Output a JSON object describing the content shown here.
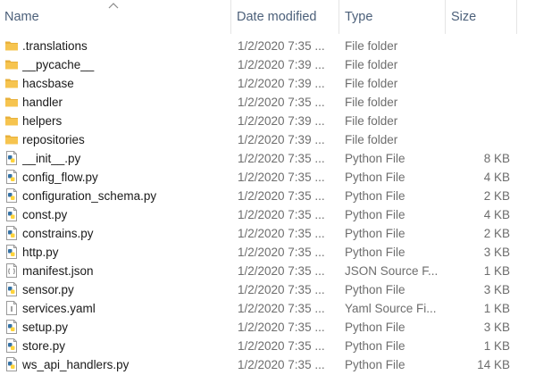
{
  "columns": {
    "name": "Name",
    "date_modified": "Date modified",
    "type": "Type",
    "size": "Size"
  },
  "colors": {
    "folder": "#f6c44f",
    "python_blue": "#3572a5",
    "python_yellow": "#ffd43b",
    "header_text": "#4c607a",
    "secondary_text": "#6d6d6d"
  },
  "files": [
    {
      "name": ".translations",
      "date": "1/2/2020 7:35 ...",
      "type": "File folder",
      "size": "",
      "icon": "folder-icon"
    },
    {
      "name": "__pycache__",
      "date": "1/2/2020 7:39 ...",
      "type": "File folder",
      "size": "",
      "icon": "folder-icon"
    },
    {
      "name": "hacsbase",
      "date": "1/2/2020 7:39 ...",
      "type": "File folder",
      "size": "",
      "icon": "folder-icon"
    },
    {
      "name": "handler",
      "date": "1/2/2020 7:35 ...",
      "type": "File folder",
      "size": "",
      "icon": "folder-icon"
    },
    {
      "name": "helpers",
      "date": "1/2/2020 7:39 ...",
      "type": "File folder",
      "size": "",
      "icon": "folder-icon"
    },
    {
      "name": "repositories",
      "date": "1/2/2020 7:39 ...",
      "type": "File folder",
      "size": "",
      "icon": "folder-icon"
    },
    {
      "name": "__init__.py",
      "date": "1/2/2020 7:35 ...",
      "type": "Python File",
      "size": "8 KB",
      "icon": "python-file-icon"
    },
    {
      "name": "config_flow.py",
      "date": "1/2/2020 7:35 ...",
      "type": "Python File",
      "size": "4 KB",
      "icon": "python-file-icon"
    },
    {
      "name": "configuration_schema.py",
      "date": "1/2/2020 7:35 ...",
      "type": "Python File",
      "size": "2 KB",
      "icon": "python-file-icon"
    },
    {
      "name": "const.py",
      "date": "1/2/2020 7:35 ...",
      "type": "Python File",
      "size": "4 KB",
      "icon": "python-file-icon"
    },
    {
      "name": "constrains.py",
      "date": "1/2/2020 7:35 ...",
      "type": "Python File",
      "size": "2 KB",
      "icon": "python-file-icon"
    },
    {
      "name": "http.py",
      "date": "1/2/2020 7:35 ...",
      "type": "Python File",
      "size": "3 KB",
      "icon": "python-file-icon"
    },
    {
      "name": "manifest.json",
      "date": "1/2/2020 7:35 ...",
      "type": "JSON Source F...",
      "size": "1 KB",
      "icon": "json-file-icon"
    },
    {
      "name": "sensor.py",
      "date": "1/2/2020 7:35 ...",
      "type": "Python File",
      "size": "3 KB",
      "icon": "python-file-icon"
    },
    {
      "name": "services.yaml",
      "date": "1/2/2020 7:35 ...",
      "type": "Yaml Source Fi...",
      "size": "1 KB",
      "icon": "yaml-file-icon"
    },
    {
      "name": "setup.py",
      "date": "1/2/2020 7:35 ...",
      "type": "Python File",
      "size": "3 KB",
      "icon": "python-file-icon"
    },
    {
      "name": "store.py",
      "date": "1/2/2020 7:35 ...",
      "type": "Python File",
      "size": "1 KB",
      "icon": "python-file-icon"
    },
    {
      "name": "ws_api_handlers.py",
      "date": "1/2/2020 7:35 ...",
      "type": "Python File",
      "size": "14 KB",
      "icon": "python-file-icon"
    }
  ]
}
